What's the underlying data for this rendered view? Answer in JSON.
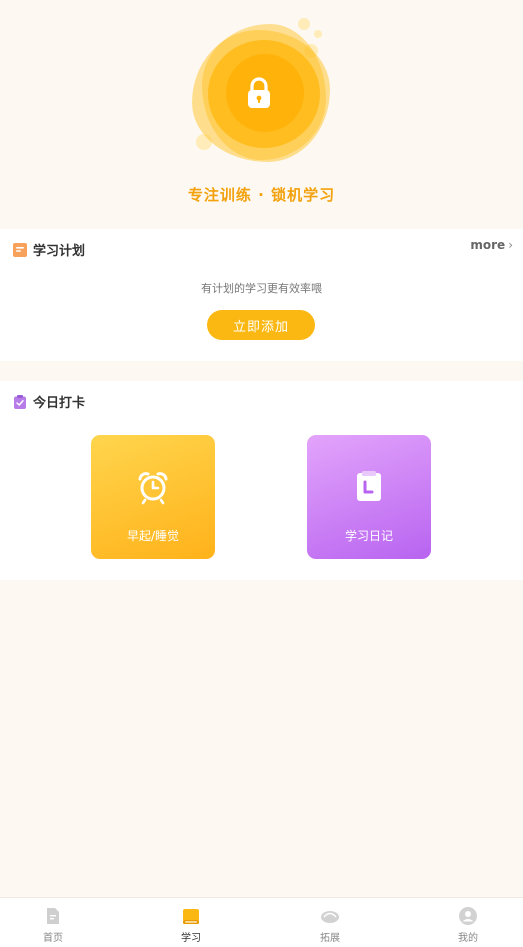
{
  "hero": {
    "title": "专注训练 · 锁机学习",
    "icon": "lock-icon"
  },
  "plan": {
    "title": "学习计划",
    "icon": "list-doc-icon",
    "more_label": "more",
    "hint": "有计划的学习更有效率喂",
    "add_button_label": "立即添加"
  },
  "checkin": {
    "title": "今日打卡",
    "icon": "clipboard-check-icon",
    "tiles": [
      {
        "label": "早起/睡觉",
        "icon": "alarm-clock-icon"
      },
      {
        "label": "学习日记",
        "icon": "notebook-icon"
      }
    ]
  },
  "bottom_nav": {
    "items": [
      {
        "label": "首页",
        "icon": "home-doc-icon",
        "active": false
      },
      {
        "label": "学习",
        "icon": "book-icon",
        "active": true
      },
      {
        "label": "拓展",
        "icon": "explore-icon",
        "active": false
      },
      {
        "label": "我的",
        "icon": "profile-icon",
        "active": false
      }
    ]
  },
  "colors": {
    "page_bg": "#fdf9f2",
    "accent": "#f3a10c",
    "button": "#fbb812",
    "wake_tile": "#ffc22b",
    "diary_tile": "#cf86f6",
    "plan_icon": "#f7a25b",
    "checkin_icon": "#b77ce8"
  }
}
